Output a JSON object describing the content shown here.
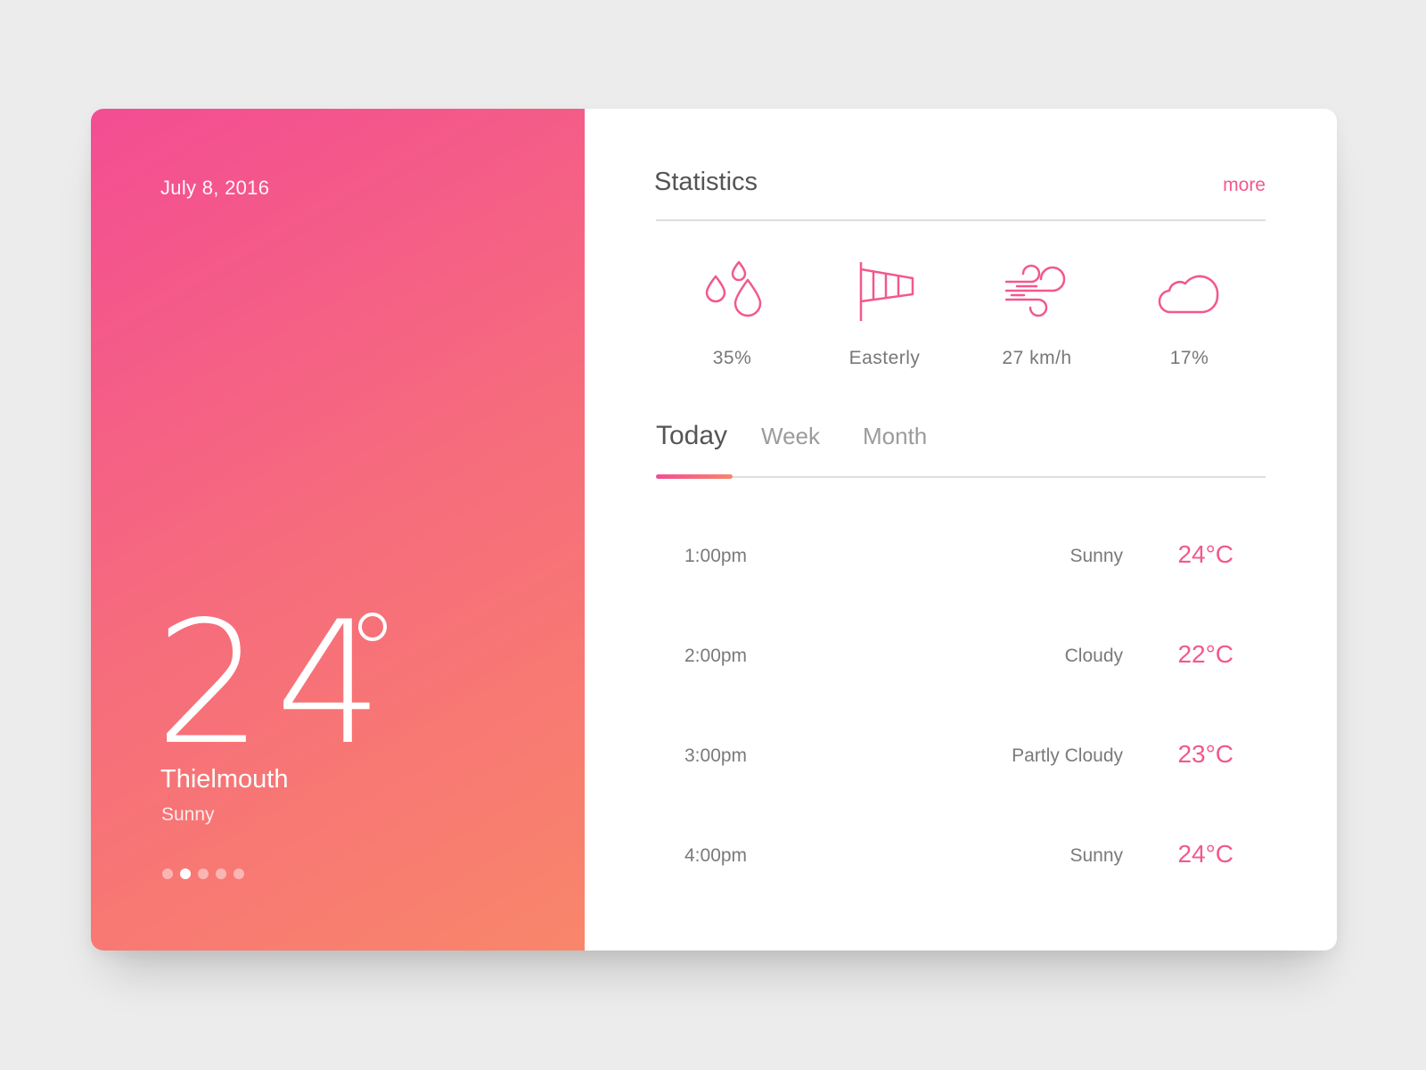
{
  "current": {
    "date": "July 8, 2016",
    "temperature": "24",
    "city": "Thielmouth",
    "condition": "Sunny",
    "pager": {
      "count": 5,
      "active_index": 1
    }
  },
  "statistics": {
    "title": "Statistics",
    "more_label": "more",
    "items": [
      {
        "icon": "humidity-drops-icon",
        "value": "35%"
      },
      {
        "icon": "windsock-icon",
        "value": "Easterly"
      },
      {
        "icon": "wind-icon",
        "value": "27 km/h"
      },
      {
        "icon": "cloud-icon",
        "value": "17%"
      }
    ]
  },
  "tabs": [
    {
      "label": "Today",
      "active": true
    },
    {
      "label": "Week",
      "active": false
    },
    {
      "label": "Month",
      "active": false
    }
  ],
  "forecast": [
    {
      "time": "1:00pm",
      "condition": "Sunny",
      "temp": "24°C"
    },
    {
      "time": "2:00pm",
      "condition": "Cloudy",
      "temp": "22°C"
    },
    {
      "time": "3:00pm",
      "condition": "Partly Cloudy",
      "temp": "23°C"
    },
    {
      "time": "4:00pm",
      "condition": "Sunny",
      "temp": "24°C"
    }
  ],
  "colors": {
    "accent": "#f2588f",
    "gradient_start": "#f34d93",
    "gradient_end": "#f9866a"
  }
}
